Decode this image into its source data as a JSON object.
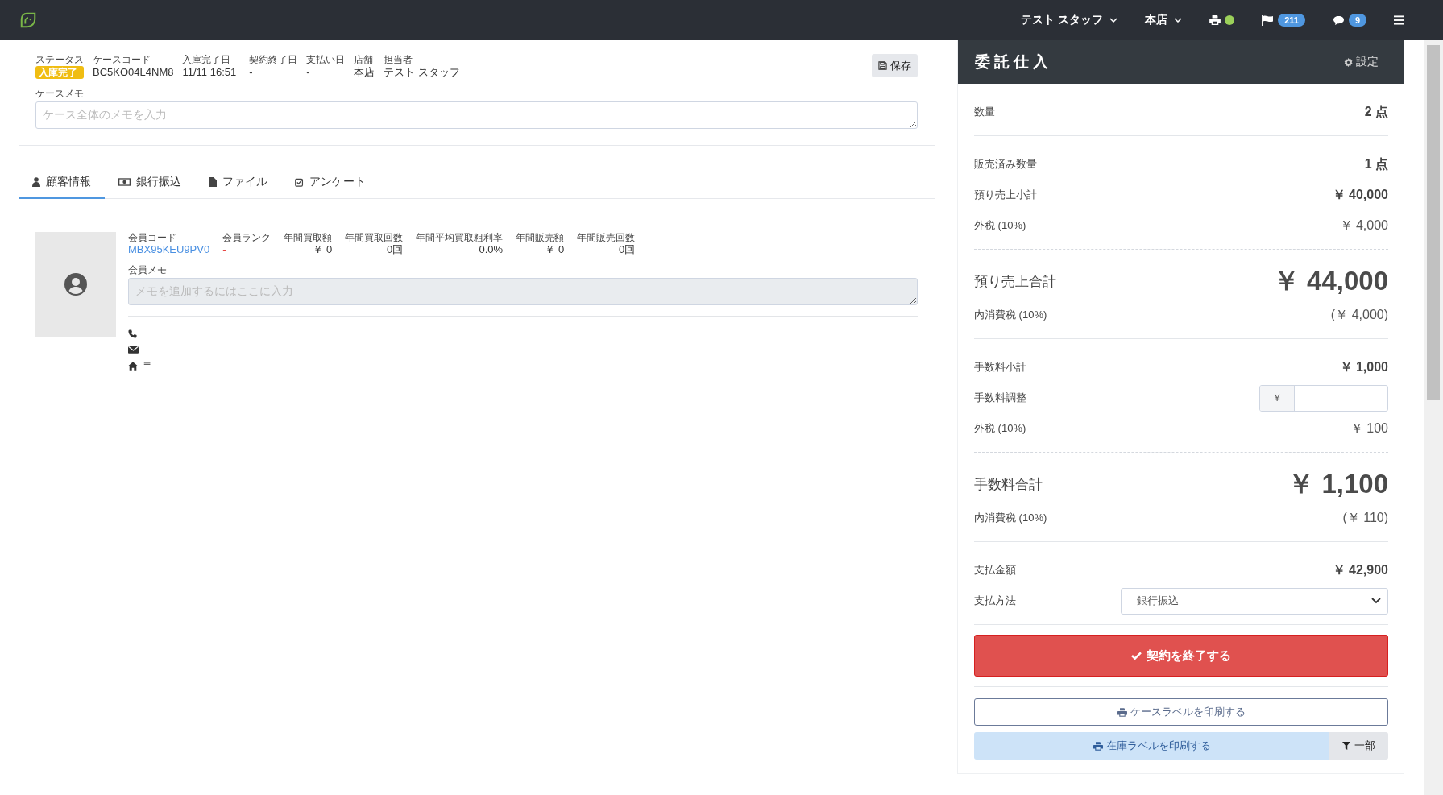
{
  "navbar": {
    "user": "テスト スタッフ",
    "store": "本店",
    "printer_online": true,
    "flag_count": "211",
    "message_count": "9"
  },
  "case": {
    "fields": [
      {
        "label": "ステータス",
        "value": "入庫完了",
        "kind": "badge"
      },
      {
        "label": "ケースコード",
        "value": "BC5KO04L4NM8",
        "kind": "text"
      },
      {
        "label": "入庫完了日",
        "value": "11/11 16:51",
        "kind": "text"
      },
      {
        "label": "契約終了日",
        "value": "-",
        "kind": "text"
      },
      {
        "label": "支払い日",
        "value": "-",
        "kind": "text"
      },
      {
        "label": "店舗",
        "value": "本店",
        "kind": "text"
      },
      {
        "label": "担当者",
        "value": "テスト スタッフ",
        "kind": "text"
      }
    ],
    "save_button": "保存",
    "memo_label": "ケースメモ",
    "memo_placeholder": "ケース全体のメモを入力"
  },
  "tabs": [
    {
      "label": "顧客情報",
      "selected": true
    },
    {
      "label": "銀行振込",
      "selected": false
    },
    {
      "label": "ファイル",
      "selected": false
    },
    {
      "label": "アンケート",
      "selected": false
    }
  ],
  "customer": {
    "fields": [
      {
        "label": "会員コード",
        "value": "MBX95KEU9PV0",
        "kind": "link"
      },
      {
        "label": "会員ランク",
        "value": "-",
        "kind": "missing"
      },
      {
        "label": "年間買取額",
        "value": "￥ 0",
        "kind": "number"
      },
      {
        "label": "年間買取回数",
        "value": "0回",
        "kind": "number"
      },
      {
        "label": "年間平均買取粗利率",
        "value": "0.0%",
        "kind": "number"
      },
      {
        "label": "年間販売額",
        "value": "￥ 0",
        "kind": "number"
      },
      {
        "label": "年間販売回数",
        "value": "0回",
        "kind": "number"
      }
    ],
    "memo_label": "会員メモ",
    "memo_placeholder": "メモを追加するにはここに入力",
    "postal_mark": "〒"
  },
  "panel": {
    "title": "委託仕入",
    "settings": "設定",
    "sections": [
      {
        "dashed": false,
        "rows": [
          {
            "kind": "strong",
            "label": "数量",
            "value": "2 点"
          }
        ]
      },
      {
        "dashed": true,
        "rows": [
          {
            "kind": "strong",
            "label": "販売済み数量",
            "value": "1 点"
          },
          {
            "kind": "strong",
            "label": "預り売上小計",
            "value": "￥ 40,000"
          },
          {
            "kind": "muted",
            "label": "外税 (10%)",
            "value": "￥ 4,000"
          }
        ]
      },
      {
        "dashed": false,
        "rows": [
          {
            "kind": "total",
            "label": "預り売上合計",
            "value": "￥ 44,000"
          },
          {
            "kind": "muted",
            "label": "内消費税 (10%)",
            "value": "(￥ 4,000)"
          }
        ]
      },
      {
        "dashed": true,
        "rows": [
          {
            "kind": "strong",
            "label": "手数料小計",
            "value": "￥ 1,000"
          },
          {
            "kind": "input",
            "label": "手数料調整",
            "prefix": "￥"
          },
          {
            "kind": "muted",
            "label": "外税 (10%)",
            "value": "￥ 100"
          }
        ]
      },
      {
        "dashed": false,
        "rows": [
          {
            "kind": "total",
            "label": "手数料合計",
            "value": "￥ 1,100"
          },
          {
            "kind": "muted",
            "label": "内消費税 (10%)",
            "value": "(￥ 110)"
          }
        ]
      },
      {
        "dashed": false,
        "rows": [
          {
            "kind": "strong",
            "label": "支払金額",
            "value": "￥ 42,900"
          },
          {
            "kind": "select",
            "label": "支払方法",
            "value": "銀行振込"
          }
        ]
      }
    ],
    "finish_button": "契約を終了する",
    "case_label_button": "ケースラベルを印刷する",
    "stock_label_button": "在庫ラベルを印刷する",
    "filter_button": "一部"
  }
}
